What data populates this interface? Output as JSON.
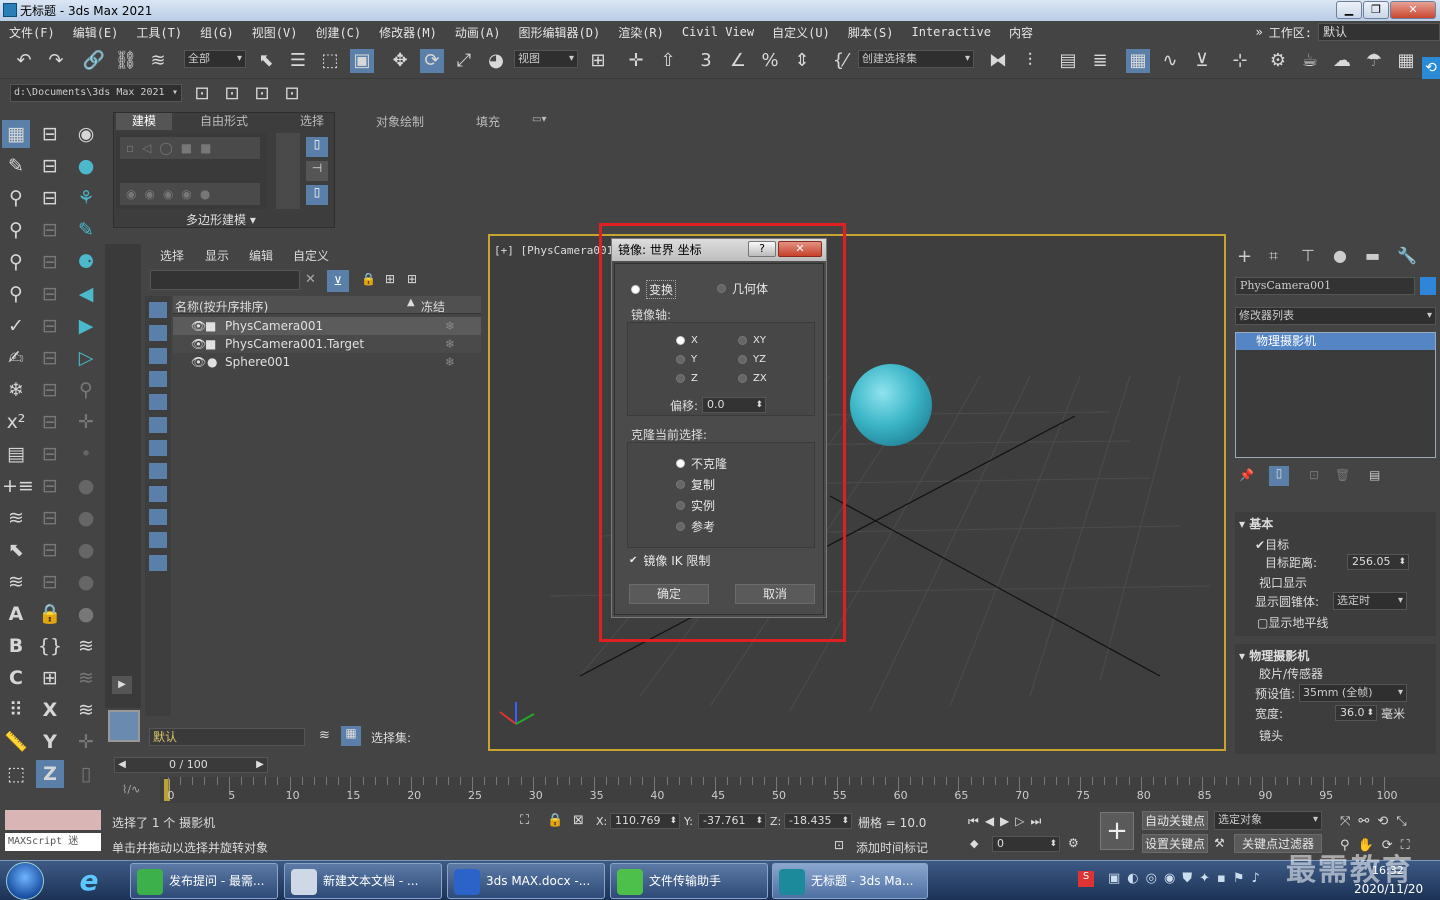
{
  "window": {
    "title": "无标题 - 3ds Max 2021"
  },
  "menu": [
    "文件(F)",
    "编辑(E)",
    "工具(T)",
    "组(G)",
    "视图(V)",
    "创建(C)",
    "修改器(M)",
    "动画(A)",
    "图形编辑器(D)",
    "渲染(R)",
    "Civil View",
    "自定义(U)",
    "脚本(S)",
    "Interactive",
    "内容"
  ],
  "workspace": {
    "label": "工作区:",
    "value": "默认"
  },
  "toolbar": {
    "filter": "全部",
    "ref_coord": "视图",
    "selection_set": "创建选择集"
  },
  "project_path": "d:\\Documents\\3ds Max 2021",
  "ribbon": {
    "tabs": [
      "建模",
      "自由形式",
      "选择",
      "对象绘制",
      "填充"
    ],
    "panel_label": "多边形建模"
  },
  "scene_explorer": {
    "menu": [
      "选择",
      "显示",
      "编辑",
      "自定义"
    ],
    "col_name": "名称(按升序排序)",
    "col_frozen": "冻结",
    "rows": [
      "PhysCamera001",
      "PhysCamera001.Target",
      "Sphere001"
    ],
    "layer": "默认",
    "selection_set_label": "选择集:"
  },
  "viewport": {
    "label": "[+] [PhysCamera001 ]"
  },
  "dialog": {
    "title": "镜像: 世界 坐标",
    "transform": "变换",
    "geometry": "几何体",
    "axis_group": "镜像轴:",
    "axes": [
      "X",
      "Y",
      "Z",
      "XY",
      "YZ",
      "ZX"
    ],
    "offset_label": "偏移:",
    "offset_value": "0.0",
    "clone_group": "克隆当前选择:",
    "clone_options": [
      "不克隆",
      "复制",
      "实例",
      "参考"
    ],
    "mirror_ik": "镜像 IK 限制",
    "ok": "确定",
    "cancel": "取消"
  },
  "right_panel": {
    "object_name": "PhysCamera001",
    "modifier_list": "修改器列表",
    "stack_item": "物理摄影机",
    "basic": {
      "title": "基本",
      "target": "目标",
      "target_dist_label": "目标距离:",
      "target_dist": "256.05",
      "viewport_display": "视口显示",
      "show_cone_label": "显示圆锥体:",
      "show_cone": "选定时",
      "show_horizon": "显示地平线"
    },
    "physical": {
      "title": "物理摄影机",
      "film": "胶片/传感器",
      "preset_label": "预设值:",
      "preset": "35mm  (全帧)",
      "width_label": "宽度:",
      "width": "36.0",
      "width_unit": "毫米",
      "lens": "镜头"
    }
  },
  "timeline": {
    "frame": "0 / 100",
    "ticks": [
      "0",
      "5",
      "10",
      "15",
      "20",
      "25",
      "30",
      "35",
      "40",
      "45",
      "50",
      "55",
      "60",
      "65",
      "70",
      "75",
      "80",
      "85",
      "90",
      "95",
      "100"
    ]
  },
  "status": {
    "maxscript": "MAXScript 迷",
    "selected": "选择了 1 个 摄影机",
    "hint": "单击并拖动以选择并旋转对象",
    "x_label": "X:",
    "x": "110.769",
    "y_label": "Y:",
    "y": "-37.761",
    "z_label": "Z:",
    "z": "-18.435",
    "grid": "栅格 = 10.0",
    "add_time_tag": "添加时间标记",
    "auto_key": "自动关键点",
    "selected_obj": "选定对象",
    "set_key": "设置关键点",
    "key_filter": "关键点过滤器",
    "frame_field": "0"
  },
  "taskbar": {
    "items": [
      "发布提问 - 最需...",
      "新建文本文档 - ...",
      "3ds MAX.docx -...",
      "文件传输助手",
      "无标题 - 3ds Ma..."
    ],
    "time": "16:32",
    "date": "2020/11/20",
    "watermark": "最需教育"
  }
}
